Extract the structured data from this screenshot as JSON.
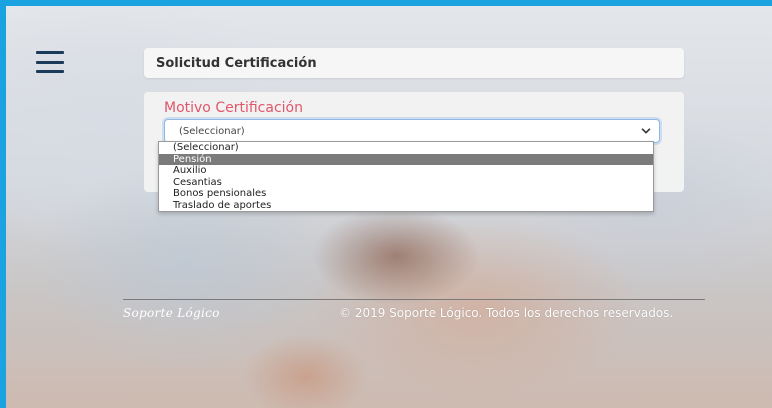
{
  "header": {
    "title": "Solicitud Certificación"
  },
  "form": {
    "motivo_label": "Motivo Certificación",
    "select_value": "(Seleccionar)",
    "options": [
      {
        "label": "(Seleccionar)",
        "highlighted": false
      },
      {
        "label": "Pensión",
        "highlighted": true
      },
      {
        "label": "Auxilio",
        "highlighted": false
      },
      {
        "label": "Cesantias",
        "highlighted": false
      },
      {
        "label": "Bonos pensionales",
        "highlighted": false
      },
      {
        "label": "Traslado de aportes",
        "highlighted": false
      }
    ]
  },
  "footer": {
    "logo_text": "Soporte Lógico",
    "copyright": "© 2019 Soporte Lógico. Todos los derechos reservados."
  },
  "colors": {
    "frame_border": "#1aa3e0",
    "label_accent": "#e0566a",
    "option_highlight": "#7b7b7b"
  },
  "icons": {
    "menu": "hamburger-menu-icon",
    "select_arrow": "chevron-down-icon"
  }
}
